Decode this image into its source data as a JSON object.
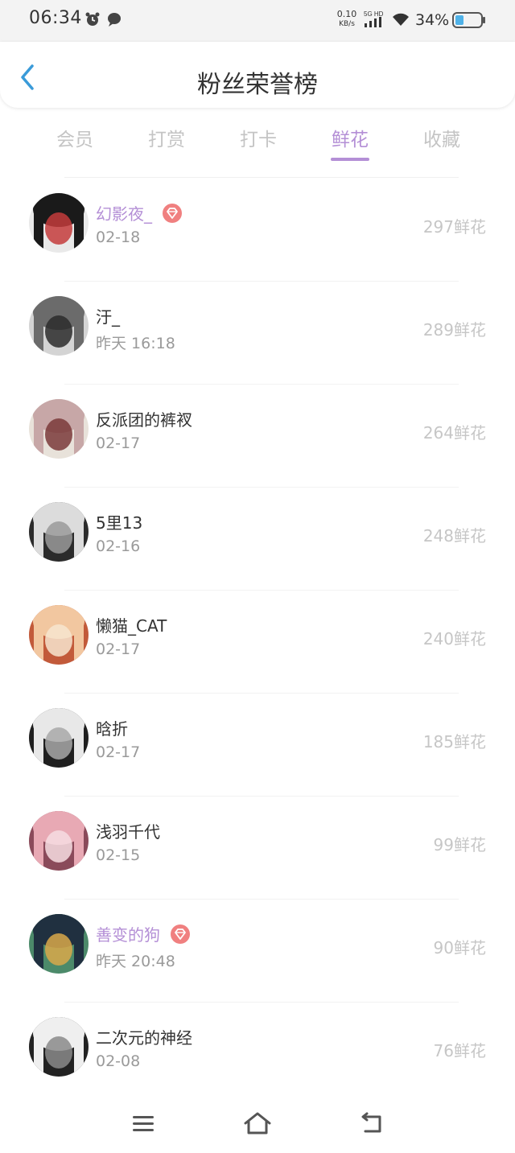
{
  "status_bar": {
    "time": "06:34",
    "net_speed_value": "0.10",
    "net_speed_unit": "KB/s",
    "network_type": "5G HD",
    "battery_percent": "34%",
    "battery_level": 0.34,
    "icons": [
      "alarm-icon",
      "chat-notification-icon",
      "signal-icon",
      "wifi-icon",
      "battery-icon"
    ]
  },
  "header": {
    "title": "粉丝荣誉榜",
    "back_icon": "chevron-left-icon"
  },
  "tabs": [
    {
      "label": "会员",
      "active": false
    },
    {
      "label": "打赏",
      "active": false
    },
    {
      "label": "打卡",
      "active": false
    },
    {
      "label": "鲜花",
      "active": true
    },
    {
      "label": "收藏",
      "active": false
    }
  ],
  "colors": {
    "accent": "#b48fd6",
    "back_icon": "#3a9bd9",
    "vip_badge": "#f08080",
    "count_text": "#c6c6c6"
  },
  "fans": [
    {
      "name": "幻影夜_",
      "time": "02-18",
      "count": "297鲜花",
      "vip": true
    },
    {
      "name": "汙_",
      "time": "昨天 16:18",
      "count": "289鲜花",
      "vip": false
    },
    {
      "name": "反派团的裤衩",
      "time": "02-17",
      "count": "264鲜花",
      "vip": false
    },
    {
      "name": "5里13",
      "time": "02-16",
      "count": "248鲜花",
      "vip": false
    },
    {
      "name": "懒猫_CAT",
      "time": "02-17",
      "count": "240鲜花",
      "vip": false
    },
    {
      "name": "晗折",
      "time": "02-17",
      "count": "185鲜花",
      "vip": false
    },
    {
      "name": "浅羽千代",
      "time": "02-15",
      "count": "99鲜花",
      "vip": false
    },
    {
      "name": "善变的狗",
      "time": "昨天 20:48",
      "count": "90鲜花",
      "vip": true
    },
    {
      "name": "二次元的神经",
      "time": "02-08",
      "count": "76鲜花",
      "vip": false
    }
  ],
  "nav_bar": {
    "icons": [
      "menu-icon",
      "home-icon",
      "back-icon"
    ]
  }
}
